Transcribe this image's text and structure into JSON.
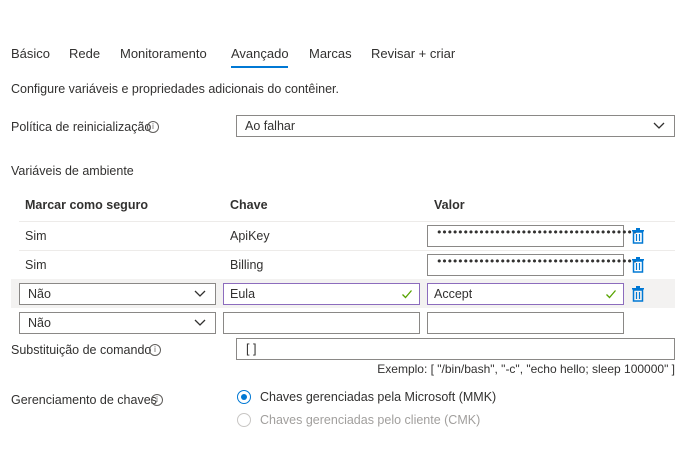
{
  "tabs": [
    {
      "label": "Básico"
    },
    {
      "label": "Rede"
    },
    {
      "label": "Monitoramento"
    },
    {
      "label": "Avançado"
    },
    {
      "label": "Marcas"
    },
    {
      "label": "Revisar + criar"
    }
  ],
  "active_tab": "Avançado",
  "description": "Configure variáveis e propriedades adicionais do contêiner.",
  "restart_policy": {
    "label": "Política de reinicialização",
    "value": "Ao falhar"
  },
  "env_vars": {
    "section_label": "Variáveis de ambiente",
    "headers": {
      "secure": "Marcar como seguro",
      "key": "Chave",
      "value": "Valor"
    },
    "rows": [
      {
        "secure": "Sim",
        "key": "ApiKey",
        "value": "••••••••••••••••••••••••••••••••••••••"
      },
      {
        "secure": "Sim",
        "key": "Billing",
        "value": "••••••••••••••••••••••••••••••••••••••"
      },
      {
        "secure": "Não",
        "key": "Eula",
        "value": "Accept"
      },
      {
        "secure": "Não",
        "key": "",
        "value": ""
      }
    ]
  },
  "command_override": {
    "label": "Substituição de comando",
    "value": "[ ]",
    "hint": "Exemplo: [ \"/bin/bash\", \"-c\", \"echo hello; sleep 100000\" ]"
  },
  "key_management": {
    "label": "Gerenciamento de chaves",
    "options": [
      {
        "label": "Chaves gerenciadas pela Microsoft (MMK)",
        "selected": true,
        "disabled": false
      },
      {
        "label": "Chaves gerenciadas pelo cliente (CMK)",
        "selected": false,
        "disabled": true
      }
    ]
  },
  "colors": {
    "accent": "#0078d4",
    "valid_border": "#8c6cbd",
    "check": "#57a300",
    "trash": "#0078d4"
  }
}
